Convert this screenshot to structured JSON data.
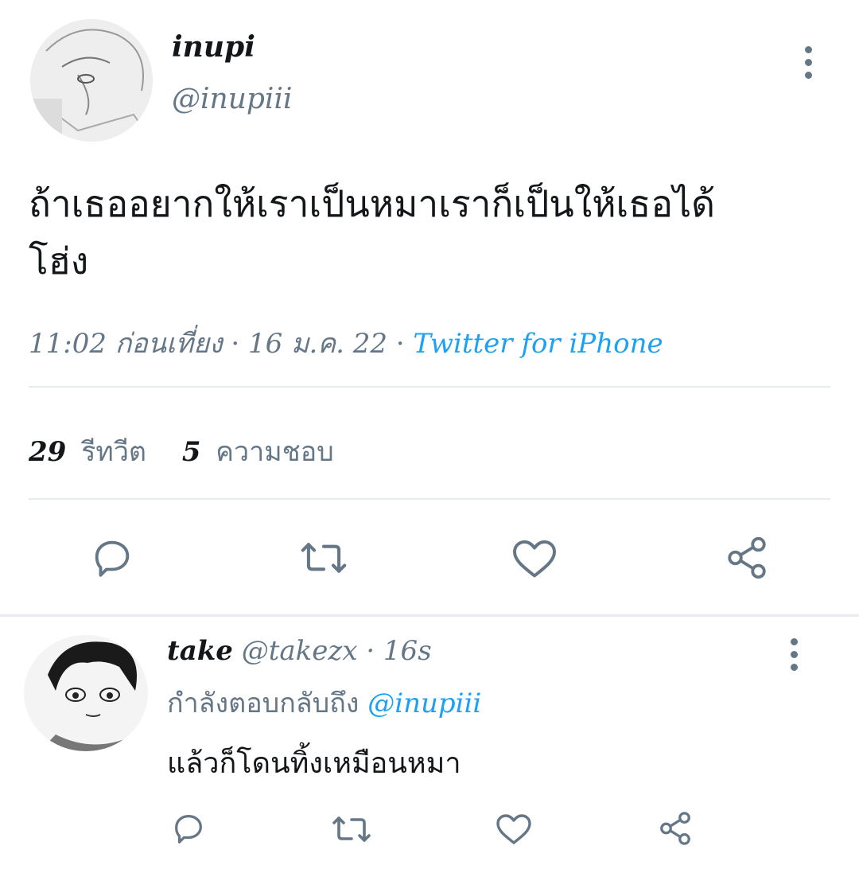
{
  "main_tweet": {
    "display_name": "inupi",
    "handle": "@inupiii",
    "text_line1": "ถ้าเธออยากให้เราเป็นหมาเราก็เป็นให้เธอได้",
    "text_line2": "โฮ่ง",
    "time": "11:02 ก่อนเที่ยง",
    "date": "16 ม.ค. 22",
    "dot": "·",
    "source": "Twitter for iPhone",
    "retweet_count": "29",
    "retweet_label": "รีทวีต",
    "like_count": "5",
    "like_label": "ความชอบ"
  },
  "reply": {
    "display_name": "take",
    "handle": "@takezx",
    "age": "· 16s",
    "replying_to_label": "กำลังตอบกลับถึง",
    "replying_to_handle": "@inupiii",
    "text": "แล้วก็โดนทิ้งเหมือนหมา"
  },
  "colors": {
    "text": "#14171a",
    "muted": "#657786",
    "accent": "#1da1f2",
    "divider": "#e6ecf0"
  },
  "icons": [
    "more-vertical-icon",
    "reply-icon",
    "retweet-icon",
    "like-icon",
    "share-icon"
  ]
}
